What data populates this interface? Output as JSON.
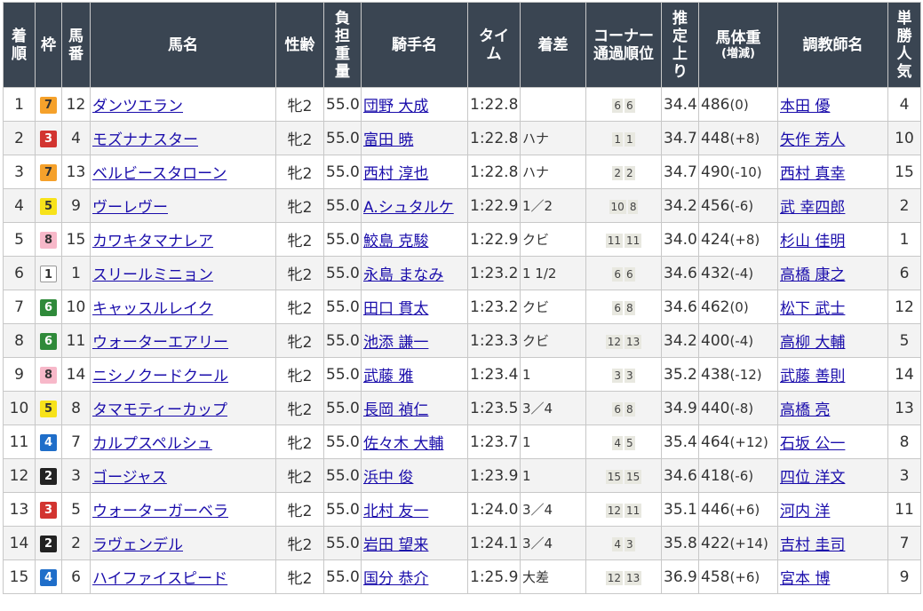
{
  "headers": {
    "rank": "着順",
    "waku": "枠",
    "umaban": "馬番",
    "name": "馬名",
    "sexage": "性齢",
    "weight": "負担重量",
    "jockey": "騎手名",
    "time": "タイム",
    "margin": "着差",
    "corner": "コーナー通過順位",
    "last3f": "推定上り",
    "body": "馬体重",
    "body_sub": "(増減)",
    "trainer": "調教師名",
    "pop": "単勝人気"
  },
  "rows": [
    {
      "rank": "1",
      "waku": "7",
      "umaban": "12",
      "name": "ダンツエラン",
      "sexage": "牝2",
      "weight": "55.0",
      "jockey": "団野 大成",
      "time": "1:22.8",
      "margin": "",
      "c1": "6",
      "c2": "6",
      "last3f": "34.4",
      "bw": "486",
      "bwd": "(0)",
      "trainer": "本田 優",
      "pop": "4"
    },
    {
      "rank": "2",
      "waku": "3",
      "umaban": "4",
      "name": "モズナナスター",
      "sexage": "牝2",
      "weight": "55.0",
      "jockey": "富田 暁",
      "time": "1:22.8",
      "margin": "ハナ",
      "c1": "1",
      "c2": "1",
      "last3f": "34.7",
      "bw": "448",
      "bwd": "(+8)",
      "trainer": "矢作 芳人",
      "pop": "10"
    },
    {
      "rank": "3",
      "waku": "7",
      "umaban": "13",
      "name": "ベルビースタローン",
      "sexage": "牝2",
      "weight": "55.0",
      "jockey": "西村 淳也",
      "time": "1:22.8",
      "margin": "ハナ",
      "c1": "2",
      "c2": "2",
      "last3f": "34.7",
      "bw": "490",
      "bwd": "(-10)",
      "trainer": "西村 真幸",
      "pop": "15"
    },
    {
      "rank": "4",
      "waku": "5",
      "umaban": "9",
      "name": "ヴーレヴー",
      "sexage": "牝2",
      "weight": "55.0",
      "jockey": "A.シュタルケ",
      "time": "1:22.9",
      "margin": "1／2",
      "c1": "10",
      "c2": "8",
      "last3f": "34.2",
      "bw": "456",
      "bwd": "(-6)",
      "trainer": "武 幸四郎",
      "pop": "2"
    },
    {
      "rank": "5",
      "waku": "8",
      "umaban": "15",
      "name": "カワキタマナレア",
      "sexage": "牝2",
      "weight": "55.0",
      "jockey": "鮫島 克駿",
      "time": "1:22.9",
      "margin": "クビ",
      "c1": "11",
      "c2": "11",
      "last3f": "34.0",
      "bw": "424",
      "bwd": "(+8)",
      "trainer": "杉山 佳明",
      "pop": "1"
    },
    {
      "rank": "6",
      "waku": "1",
      "umaban": "1",
      "name": "スリールミニョン",
      "sexage": "牝2",
      "weight": "55.0",
      "jockey": "永島 まなみ",
      "time": "1:23.2",
      "margin": "1 1/2",
      "c1": "6",
      "c2": "6",
      "last3f": "34.6",
      "bw": "432",
      "bwd": "(-4)",
      "trainer": "高橋 康之",
      "pop": "6"
    },
    {
      "rank": "7",
      "waku": "6",
      "umaban": "10",
      "name": "キャッスルレイク",
      "sexage": "牝2",
      "weight": "55.0",
      "jockey": "田口 貫太",
      "time": "1:23.2",
      "margin": "クビ",
      "c1": "6",
      "c2": "8",
      "last3f": "34.6",
      "bw": "462",
      "bwd": "(0)",
      "trainer": "松下 武士",
      "pop": "12"
    },
    {
      "rank": "8",
      "waku": "6",
      "umaban": "11",
      "name": "ウォーターエアリー",
      "sexage": "牝2",
      "weight": "55.0",
      "jockey": "池添 謙一",
      "time": "1:23.3",
      "margin": "クビ",
      "c1": "12",
      "c2": "13",
      "last3f": "34.2",
      "bw": "400",
      "bwd": "(-4)",
      "trainer": "高柳 大輔",
      "pop": "5"
    },
    {
      "rank": "9",
      "waku": "8",
      "umaban": "14",
      "name": "ニシノクードクール",
      "sexage": "牝2",
      "weight": "55.0",
      "jockey": "武藤 雅",
      "time": "1:23.4",
      "margin": "1",
      "c1": "3",
      "c2": "3",
      "last3f": "35.2",
      "bw": "438",
      "bwd": "(-12)",
      "trainer": "武藤 善則",
      "pop": "14"
    },
    {
      "rank": "10",
      "waku": "5",
      "umaban": "8",
      "name": "タマモティーカップ",
      "sexage": "牝2",
      "weight": "55.0",
      "jockey": "長岡 禎仁",
      "time": "1:23.5",
      "margin": "3／4",
      "c1": "6",
      "c2": "8",
      "last3f": "34.9",
      "bw": "440",
      "bwd": "(-8)",
      "trainer": "高橋 亮",
      "pop": "13"
    },
    {
      "rank": "11",
      "waku": "4",
      "umaban": "7",
      "name": "カルプスペルシュ",
      "sexage": "牝2",
      "weight": "55.0",
      "jockey": "佐々木 大輔",
      "time": "1:23.7",
      "margin": "1",
      "c1": "4",
      "c2": "5",
      "last3f": "35.4",
      "bw": "464",
      "bwd": "(+12)",
      "trainer": "石坂 公一",
      "pop": "8"
    },
    {
      "rank": "12",
      "waku": "2",
      "umaban": "3",
      "name": "ゴージャス",
      "sexage": "牝2",
      "weight": "55.0",
      "jockey": "浜中 俊",
      "time": "1:23.9",
      "margin": "1",
      "c1": "15",
      "c2": "15",
      "last3f": "34.6",
      "bw": "418",
      "bwd": "(-6)",
      "trainer": "四位 洋文",
      "pop": "3"
    },
    {
      "rank": "13",
      "waku": "3",
      "umaban": "5",
      "name": "ウォーターガーベラ",
      "sexage": "牝2",
      "weight": "55.0",
      "jockey": "北村 友一",
      "time": "1:24.0",
      "margin": "3／4",
      "c1": "12",
      "c2": "11",
      "last3f": "35.1",
      "bw": "446",
      "bwd": "(+6)",
      "trainer": "河内 洋",
      "pop": "11"
    },
    {
      "rank": "14",
      "waku": "2",
      "umaban": "2",
      "name": "ラヴェンデル",
      "sexage": "牝2",
      "weight": "55.0",
      "jockey": "岩田 望来",
      "time": "1:24.1",
      "margin": "3／4",
      "c1": "4",
      "c2": "3",
      "last3f": "35.8",
      "bw": "422",
      "bwd": "(+14)",
      "trainer": "吉村 圭司",
      "pop": "7"
    },
    {
      "rank": "15",
      "waku": "4",
      "umaban": "6",
      "name": "ハイファイスピード",
      "sexage": "牝2",
      "weight": "55.0",
      "jockey": "国分 恭介",
      "time": "1:25.9",
      "margin": "大差",
      "c1": "12",
      "c2": "13",
      "last3f": "36.9",
      "bw": "458",
      "bwd": "(+6)",
      "trainer": "宮本 博",
      "pop": "9"
    }
  ]
}
